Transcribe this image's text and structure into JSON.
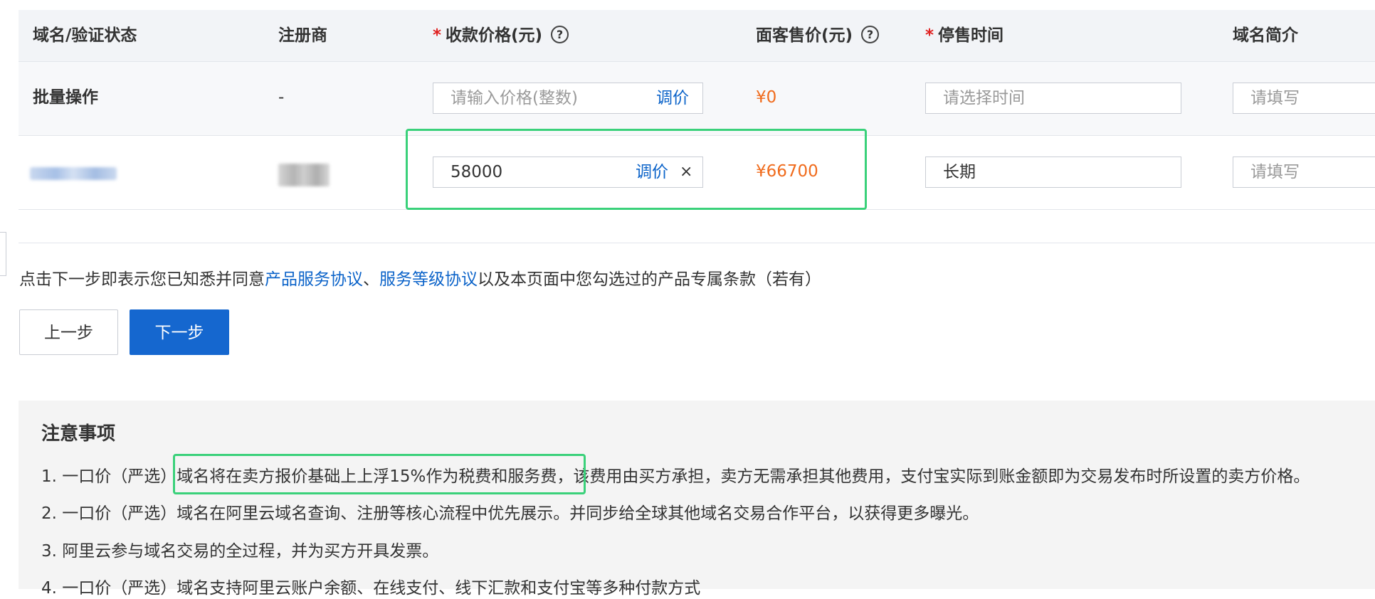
{
  "table": {
    "headers": {
      "domain": "域名/验证状态",
      "registrar": "注册商",
      "collect_price": "收款价格(元)",
      "face_price": "面客售价(元)",
      "stop_time": "停售时间",
      "intro": "域名简介"
    },
    "required_mark": "*",
    "help_icon": "?",
    "batch_row": {
      "label": "批量操作",
      "registrar": "-",
      "price_placeholder": "请输入价格(整数)",
      "adjust_label": "调价",
      "face_price": "¥0",
      "time_placeholder": "请选择时间",
      "intro_placeholder": "请填写"
    },
    "rows": [
      {
        "price_value": "58000",
        "adjust_label": "调价",
        "clear_icon": "×",
        "face_price": "¥66700",
        "stop_time": "长期",
        "intro_placeholder": "请填写"
      }
    ]
  },
  "agreement": {
    "prefix": "点击下一步即表示您已知悉并同意",
    "link1": "产品服务协议",
    "sep": "、",
    "link2": "服务等级协议",
    "suffix": "以及本页面中您勾选过的产品专属条款（若有）"
  },
  "buttons": {
    "prev": "上一步",
    "next": "下一步"
  },
  "notice": {
    "title": "注意事项",
    "items": [
      {
        "pre": "1. 一口价（严选）",
        "highlight": "域名将在卖方报价基础上上浮15%作为税费和服务费，",
        "post": "该费用由买方承担，卖方无需承担其他费用，支付宝实际到账金额即为交易发布时所设置的卖方价格。"
      },
      {
        "text": "2. 一口价（严选）域名在阿里云域名查询、注册等核心流程中优先展示。并同步给全球其他域名交易合作平台，以获得更多曝光。"
      },
      {
        "text": "3. 阿里云参与域名交易的全过程，并为买方开具发票。"
      },
      {
        "text": "4. 一口价（严选）域名支持阿里云账户余额、在线支付、线下汇款和支付宝等多种付款方式"
      }
    ]
  },
  "colors": {
    "accent_blue": "#1567cf",
    "price_orange": "#f06b1c",
    "highlight_green": "#3ad17a",
    "required_red": "#e02020"
  }
}
